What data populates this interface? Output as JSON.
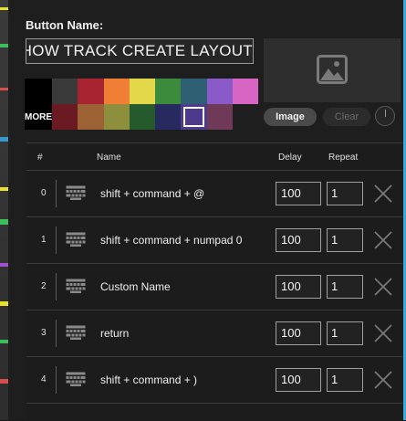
{
  "editor": {
    "button_name_label": "Button Name:",
    "button_name_value": "SHOW TRACK CREATE LAYOUT",
    "more_label": "MORE",
    "image_button": "Image",
    "clear_button": "Clear"
  },
  "palette": {
    "top": [
      "#000000",
      "#3a3a3a",
      "#a82430",
      "#f07f35",
      "#e2d84a",
      "#3c8a3c",
      "#2f5f72",
      "#8a5ac8",
      "#d665c4"
    ],
    "bottom": [
      "#6b1a24",
      "#9c6234",
      "#8e8f3c",
      "#245a2c",
      "#262a5e",
      "#4e3a8c",
      "#6e3a58"
    ],
    "selected_index": 5
  },
  "table": {
    "headers": {
      "index": "#",
      "name": "Name",
      "delay": "Delay",
      "repeat": "Repeat"
    },
    "rows": [
      {
        "index": "0",
        "name": "shift + command + @",
        "delay": "100",
        "repeat": "1"
      },
      {
        "index": "1",
        "name": "shift + command + numpad 0",
        "delay": "100",
        "repeat": "1"
      },
      {
        "index": "2",
        "name": "Custom Name",
        "delay": "100",
        "repeat": "1"
      },
      {
        "index": "3",
        "name": "return",
        "delay": "100",
        "repeat": "1"
      },
      {
        "index": "4",
        "name": "shift + command + )",
        "delay": "100",
        "repeat": "1"
      }
    ]
  },
  "colors": {
    "panel": "#1e1e1e",
    "border": "#3c3c3c",
    "selected_outline": "#ffffff"
  },
  "icons": {
    "row_type": "keyboard-icon",
    "row_delete": "close-icon",
    "image_placeholder": "image-icon"
  }
}
